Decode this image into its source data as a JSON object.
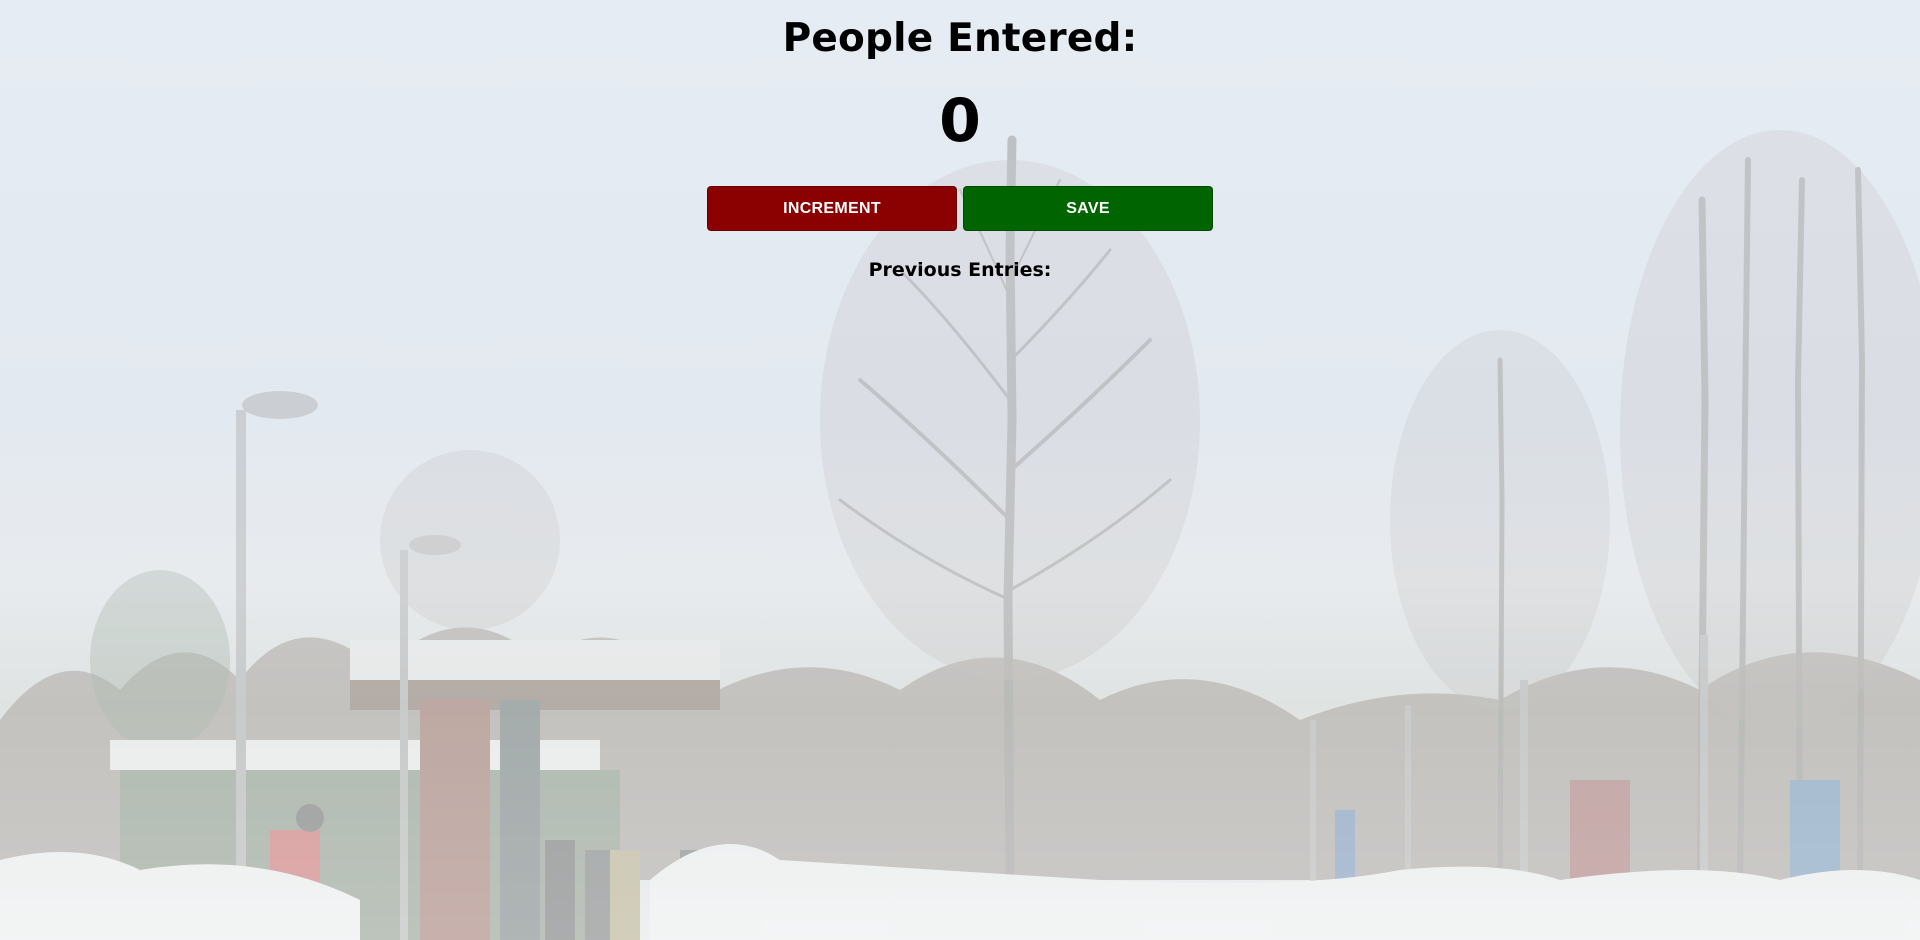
{
  "counter": {
    "title": "People Entered:",
    "value": "0"
  },
  "buttons": {
    "increment_label": "INCREMENT",
    "save_label": "SAVE"
  },
  "entries": {
    "heading": "Previous Entries:",
    "items": []
  },
  "colors": {
    "increment_button": "#8b0000",
    "save_button": "#006400",
    "text": "#000000"
  }
}
